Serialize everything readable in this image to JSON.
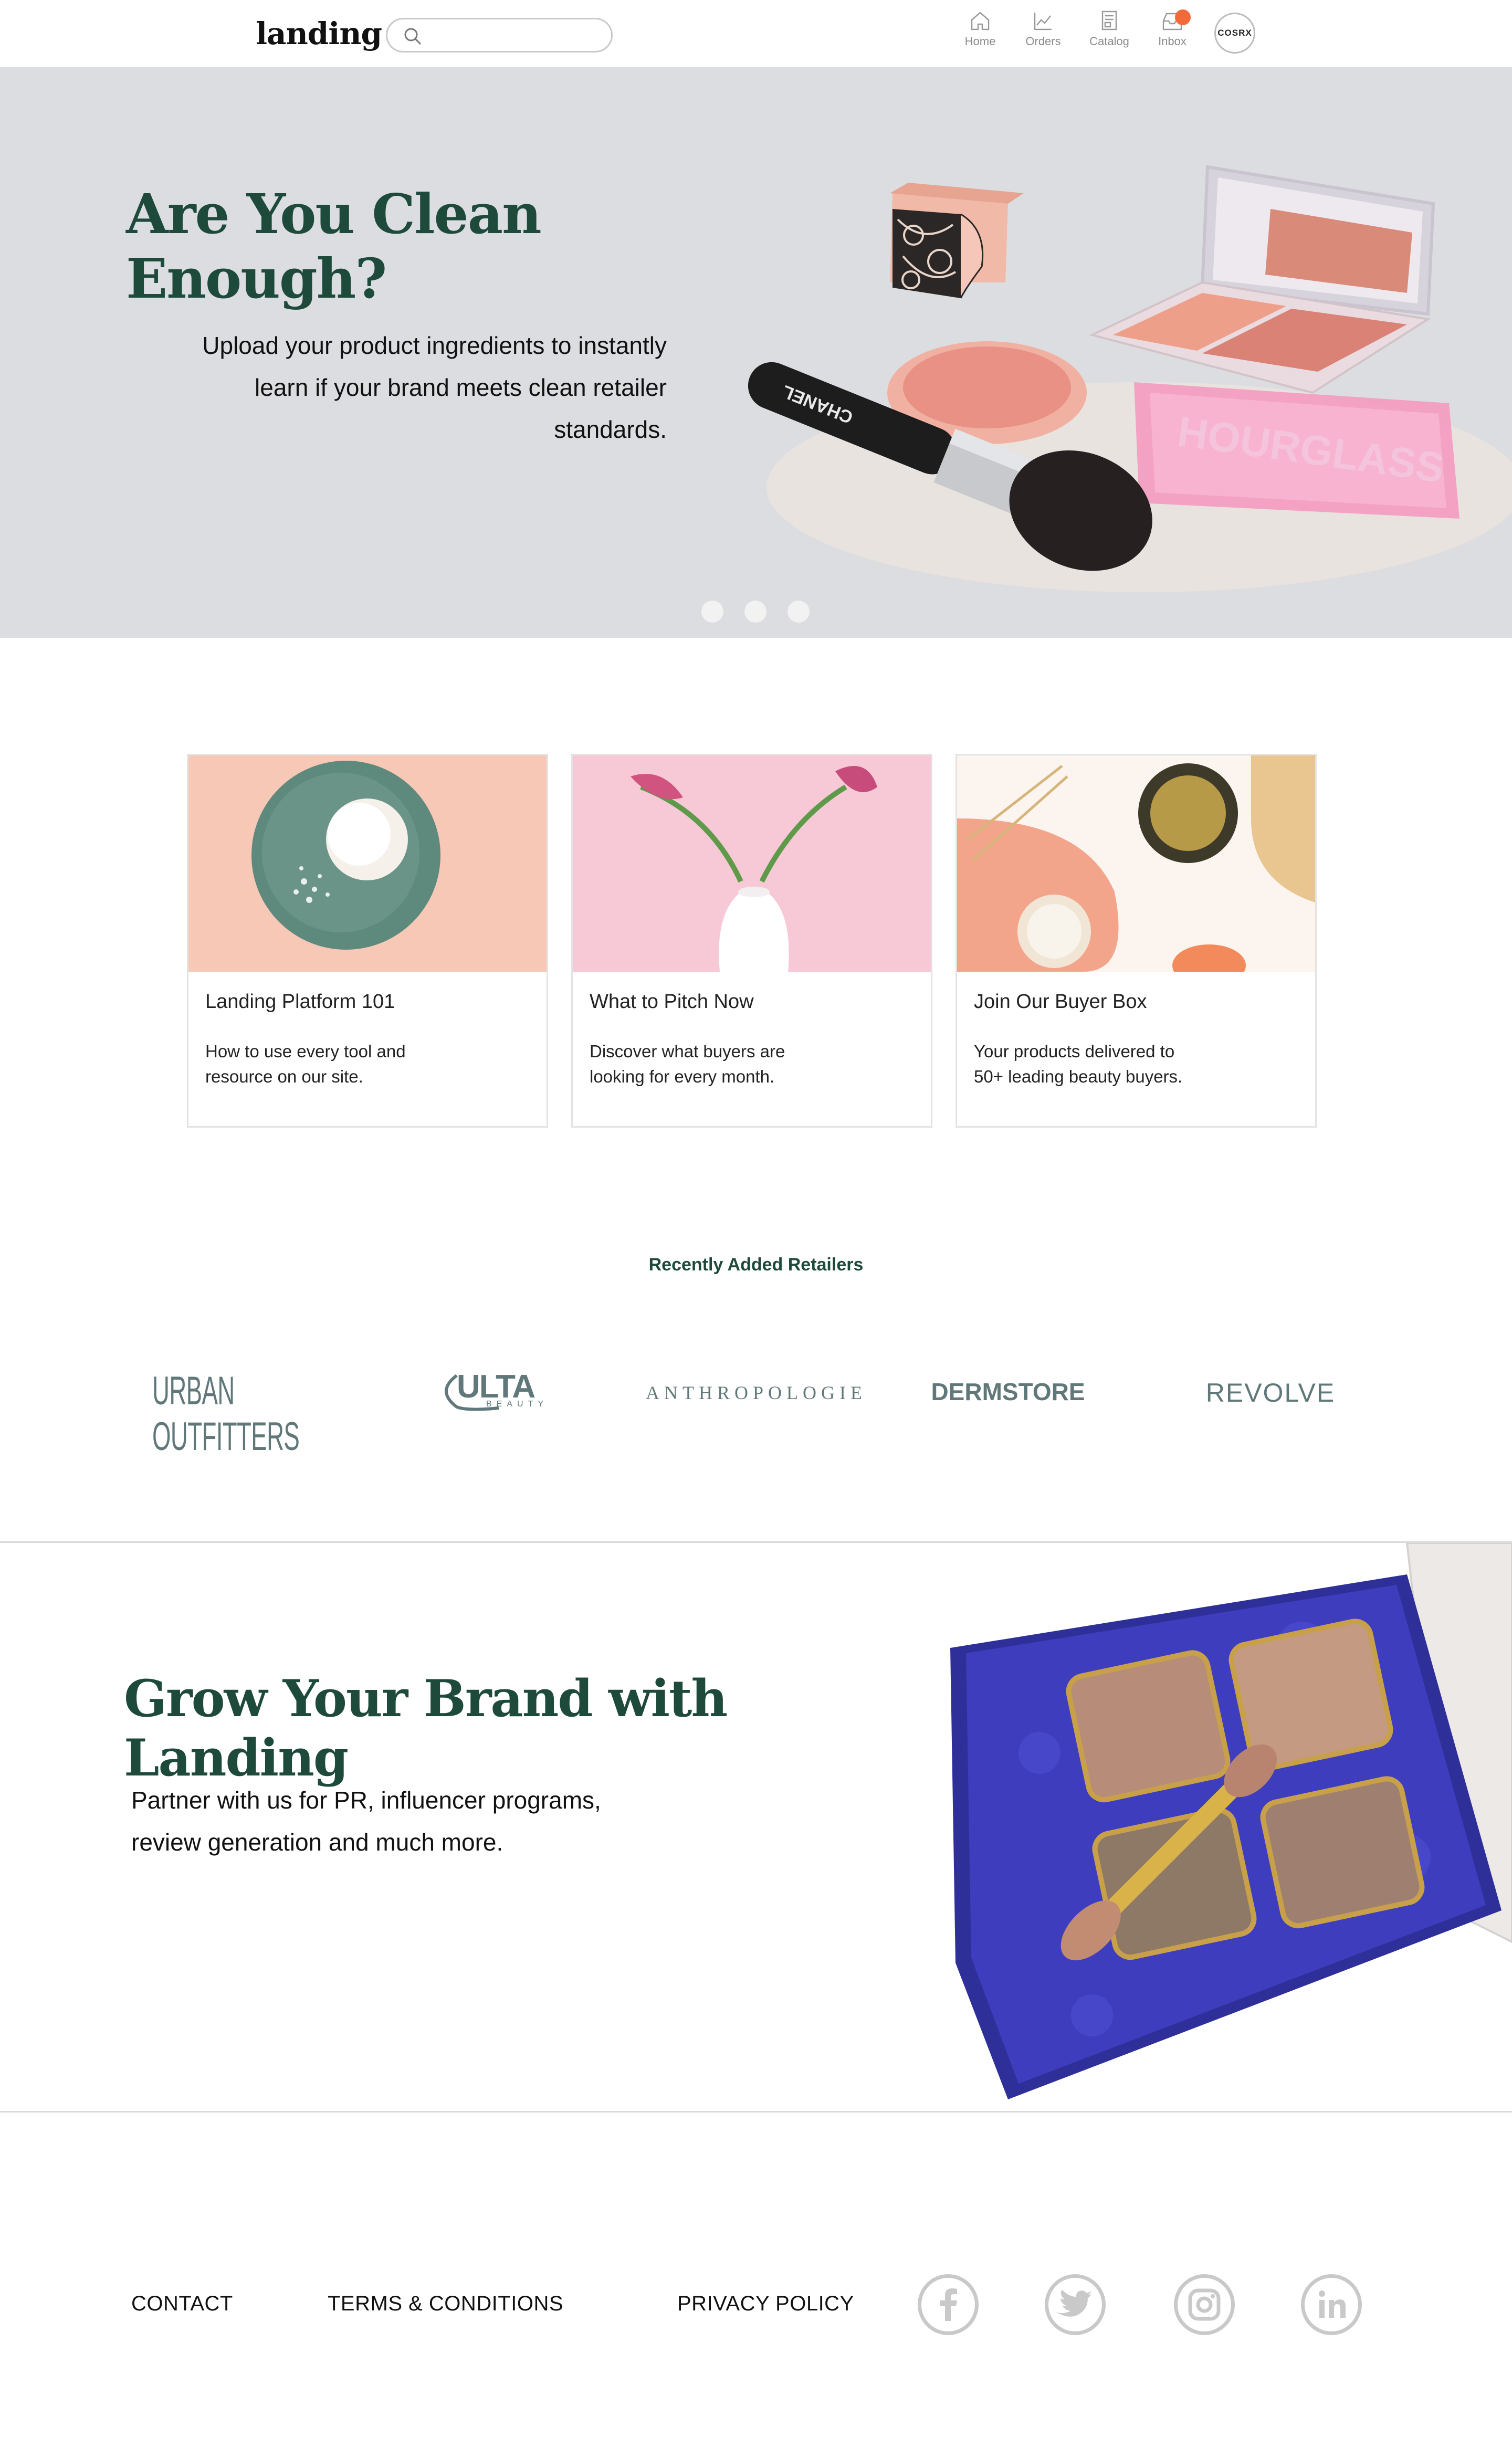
{
  "header": {
    "logo": "landing",
    "search_placeholder": "",
    "nav": [
      {
        "label": "Home",
        "icon": "home-icon"
      },
      {
        "label": "Orders",
        "icon": "chart-icon"
      },
      {
        "label": "Catalog",
        "icon": "catalog-icon"
      },
      {
        "label": "Inbox",
        "icon": "inbox-icon"
      }
    ],
    "avatar_text": "COSRX",
    "badge_color": "#f26a3a"
  },
  "hero": {
    "title": "Are You Clean Enough?",
    "subtitle_lines": [
      "Upload your product ingredients to instantly",
      "learn if your brand meets clean retailer",
      "standards."
    ],
    "brush_text": "CHANEL",
    "pouch_text": "HOURGLASS",
    "slides": 3
  },
  "cards": [
    {
      "title": "Landing Platform 101",
      "desc_lines": [
        "How to use every tool and",
        "resource on our site."
      ]
    },
    {
      "title": "What to Pitch Now",
      "desc_lines": [
        "Discover what buyers are",
        "looking for every month."
      ]
    },
    {
      "title": "Join Our Buyer Box",
      "desc_lines": [
        "Your products delivered to",
        "50+ leading beauty buyers."
      ]
    }
  ],
  "retailers": {
    "heading": "Recently Added Retailers",
    "logos": [
      {
        "name": "URBAN OUTFITTERS"
      },
      {
        "name": "ULTA",
        "tagline": "BEAUTY"
      },
      {
        "name": "ANTHROPOLOGIE"
      },
      {
        "name": "DERMSTORE"
      },
      {
        "name": "REVOLVE"
      }
    ]
  },
  "grow": {
    "title": "Grow Your Brand with Landing",
    "subtitle_lines": [
      "Partner with us for PR, influencer programs,",
      "review generation and much more."
    ]
  },
  "footer": {
    "links": [
      "CONTACT",
      "TERMS & CONDITIONS",
      "PRIVACY POLICY"
    ],
    "social": [
      "facebook-icon",
      "twitter-icon",
      "instagram-icon",
      "linkedin-icon"
    ]
  },
  "colors": {
    "brand_green": "#1e4a3b",
    "hero_bg": "#dcdde0",
    "retailer_gray": "#61787a",
    "social_gray": "#c9c9c9"
  }
}
